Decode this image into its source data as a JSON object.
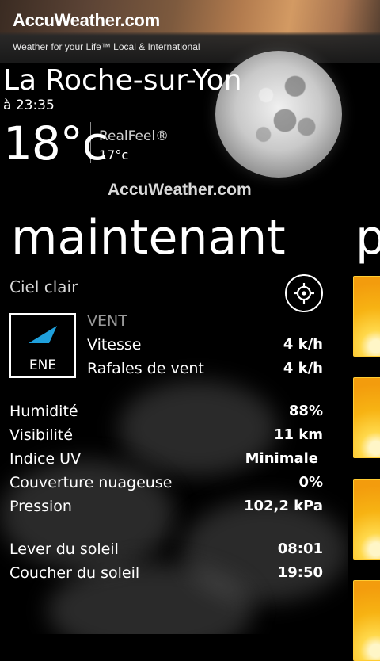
{
  "banner": {
    "logo": "AccuWeather.com",
    "tagline": "Weather for your Life™ Local & International"
  },
  "header": {
    "city": "La Roche-sur-Yon",
    "time": "à 23:35",
    "temperature": "18°c",
    "realfeel_label": "RealFeel®",
    "realfeel_value": "17°c",
    "sky_icon": "moon-icon"
  },
  "mid_logo": "AccuWeather.com",
  "panorama": {
    "title": "maintenant",
    "next_title": "p"
  },
  "now": {
    "condition": "Ciel clair",
    "locate_icon": "crosshair-icon",
    "wind": {
      "direction": "ENE",
      "title": "VENT",
      "speed_label": "Vitesse",
      "speed_value": "4 k/h",
      "gust_label": "Rafales de vent",
      "gust_value": "4 k/h"
    },
    "details": [
      {
        "label": "Humidité",
        "value": "88%"
      },
      {
        "label": "Visibilité",
        "value": "11 km"
      },
      {
        "label": "Indice UV",
        "value": "Minimale"
      },
      {
        "label": "Couverture nuageuse",
        "value": "0%"
      },
      {
        "label": "Pression",
        "value": "102,2 kPa"
      }
    ],
    "sun": [
      {
        "label": "Lever du soleil",
        "value": "08:01"
      },
      {
        "label": "Coucher du soleil",
        "value": "19:50"
      }
    ]
  },
  "colors": {
    "background": "#000000",
    "wind_arrow": "#1fa0dc",
    "forecast_card": "#f7b313"
  }
}
